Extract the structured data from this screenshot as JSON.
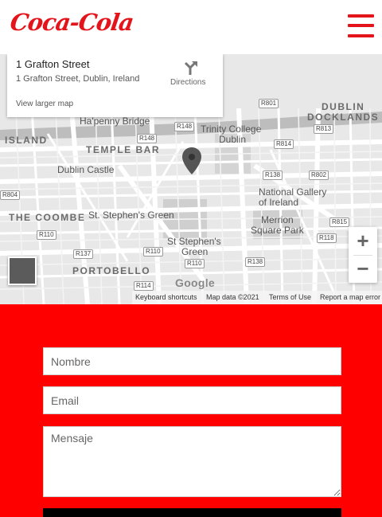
{
  "header": {
    "logo_text": "Coca-Cola",
    "menu_icon": "hamburger-menu-icon",
    "brand_color": "#e4141b"
  },
  "map": {
    "card": {
      "title": "1 Grafton Street",
      "address": "1 Grafton Street, Dublin, Ireland",
      "link": "View larger map",
      "directions_label": "Directions",
      "directions_icon": "directions-arrow-icon"
    },
    "places": {
      "hapenny": "Ha'penny Bridge",
      "trinity": "Trinity College",
      "trinity2": "Dublin",
      "temple": "TEMPLE BAR",
      "dublin_docklands": "DUBLIN",
      "docklands": "DOCKLANDS",
      "island": "ISLAND",
      "castle": "Dublin Castle",
      "gallery1": "National Gallery",
      "gallery2": "of Ireland",
      "coombe": "THE COOMBE",
      "ststephens": "St. Stephen's Green",
      "merrion1": "Merrion",
      "merrion2": "Square Park",
      "ssg1": "St Stephen's",
      "ssg2": "Green",
      "portobello": "PORTOBELLO"
    },
    "roads": [
      "R801",
      "R813",
      "R148",
      "R814",
      "R138",
      "R802",
      "R804",
      "R110",
      "R815",
      "R118",
      "R137",
      "R110",
      "R110",
      "R138",
      "R114",
      "R148"
    ],
    "zoom_in": "+",
    "zoom_out": "−",
    "google": "Google",
    "attribution": {
      "shortcuts": "Keyboard shortcuts",
      "mapdata": "Map data ©2021",
      "terms": "Terms of Use",
      "report": "Report a map error"
    }
  },
  "form": {
    "name_placeholder": "Nombre",
    "email_placeholder": "Email",
    "message_placeholder": "Mensaje",
    "background_color": "#ff0000"
  }
}
